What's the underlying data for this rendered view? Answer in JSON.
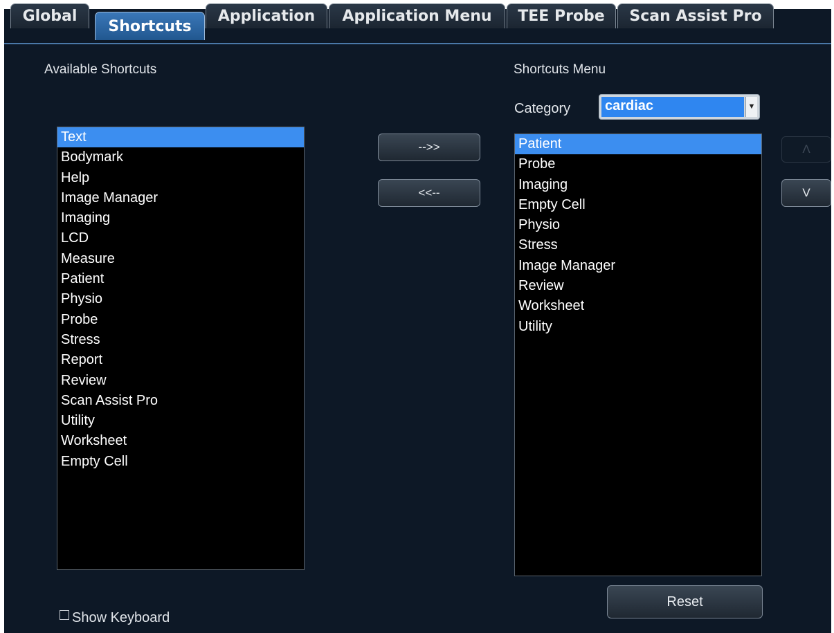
{
  "tabs": [
    {
      "label": "Global",
      "active": false
    },
    {
      "label": "Shortcuts",
      "active": true
    },
    {
      "label": "Application",
      "active": false
    },
    {
      "label": "Application Menu",
      "active": false
    },
    {
      "label": "TEE Probe",
      "active": false
    },
    {
      "label": "Scan Assist Pro",
      "active": false
    }
  ],
  "available": {
    "title": "Available Shortcuts",
    "selected": "Text",
    "items": [
      "Text",
      "Bodymark",
      "Help",
      "Image Manager",
      "Imaging",
      "LCD",
      "Measure",
      "Patient",
      "Physio",
      "Probe",
      "Stress",
      "Report",
      "Review",
      "Scan Assist Pro",
      "Utility",
      "Worksheet",
      "Empty Cell"
    ]
  },
  "transfer": {
    "add_label": "-->>",
    "remove_label": "<<--"
  },
  "menu": {
    "title": "Shortcuts Menu",
    "category_label": "Category",
    "category_value": "cardiac",
    "selected": "Patient",
    "items": [
      "Patient",
      "Probe",
      "Imaging",
      "Empty Cell",
      "Physio",
      "Stress",
      "Image Manager",
      "Review",
      "Worksheet",
      "Utility"
    ]
  },
  "order": {
    "up_label": "Λ",
    "down_label": "V",
    "up_enabled": false
  },
  "reset_label": "Reset",
  "show_keyboard": {
    "label": "Show Keyboard",
    "checked": false
  },
  "colors": {
    "background": "#0d1826",
    "selection": "#3c8ef0",
    "active_tab": "#2f6aa8"
  }
}
